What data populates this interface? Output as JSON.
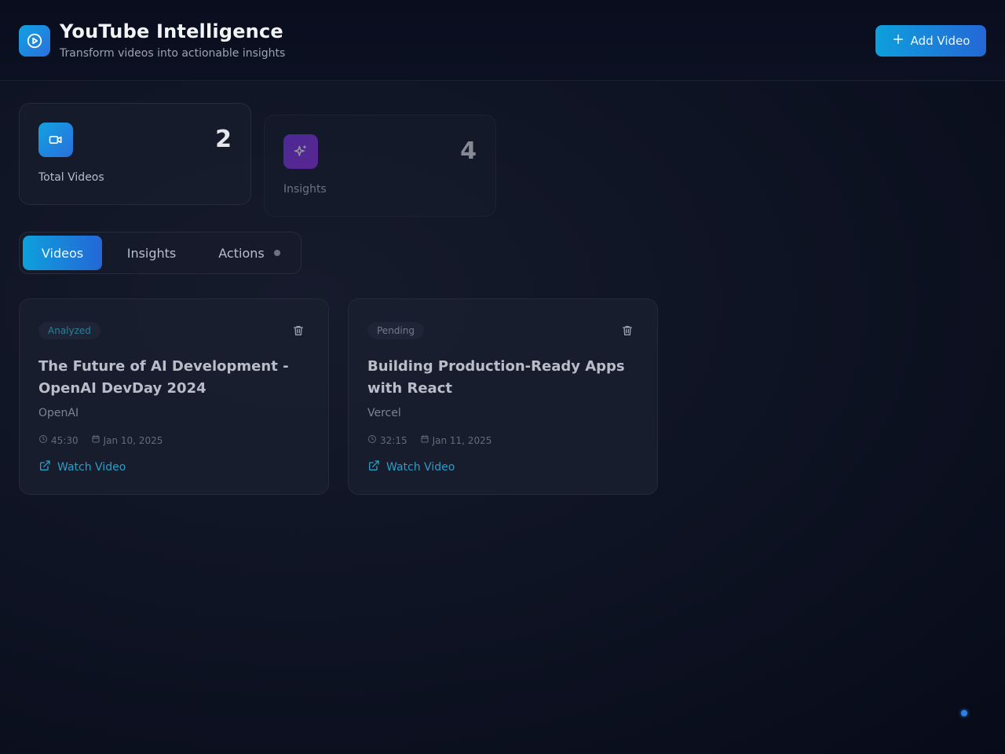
{
  "header": {
    "title": "YouTube Intelligence",
    "subtitle": "Transform videos into actionable insights",
    "logo_icon": "play-circle-icon",
    "add_button_label": "Add Video",
    "add_button_icon": "plus-icon"
  },
  "stats": [
    {
      "label": "Total Videos",
      "value": "2",
      "icon": "video-camera-icon",
      "color": "#0ea5e9"
    },
    {
      "label": "Insights",
      "value": "4",
      "icon": "sparkles-icon",
      "color": "#7c3aed"
    }
  ],
  "tabs": [
    {
      "label": "Videos",
      "active": true
    },
    {
      "label": "Insights",
      "active": false
    },
    {
      "label": "Actions",
      "active": false,
      "indicator": true
    }
  ],
  "videos": [
    {
      "status": "Analyzed",
      "title": "The Future of AI Development - OpenAI DevDay 2024",
      "channel": "OpenAI",
      "duration": "45:30",
      "date": "Jan 10, 2025",
      "link_label": "Watch Video"
    },
    {
      "status": "Pending",
      "title": "Building Production-Ready Apps with React",
      "channel": "Vercel",
      "duration": "32:15",
      "date": "Jan 11, 2025",
      "link_label": "Watch Video"
    }
  ],
  "colors": {
    "accent": "#0ea0dc",
    "accent_end": "#2467d6",
    "link": "#2b9ec6",
    "background": "#0f1424"
  }
}
